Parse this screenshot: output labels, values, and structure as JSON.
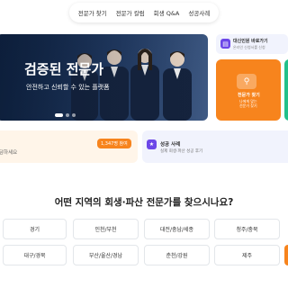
{
  "nav": {
    "items": [
      "전문가 찾기",
      "전문가 칼럼",
      "회생 Q&A",
      "성공사례"
    ]
  },
  "hero": {
    "title": "검증된 전문가",
    "subtitle": "안전하고 신뢰할 수 있는 플랫폼",
    "slide_count": 3,
    "active_slide": 1
  },
  "side_top": {
    "label": "대신인원 바로가기",
    "sub": "온라인 신청서를 신청"
  },
  "orange_card": {
    "label": "전문가 찾기",
    "sub": "나에게 맞는 전문가 찾기"
  },
  "band_left": {
    "text": "담하세요",
    "badge": "1,347명 참여"
  },
  "band_right": {
    "title": "성공 사례",
    "sub": "실제 회생·파산 성공 후기"
  },
  "region": {
    "heading": "어떤 지역의 회생·파산 전문가를 찾으시나요?",
    "row1": [
      "경기",
      "인천/부천",
      "대전/충남/세종",
      "청주/충북"
    ],
    "row2": [
      "대구/경북",
      "부산/울산/경남",
      "춘천/강원",
      "제주"
    ]
  },
  "colors": {
    "accent_orange": "#f7841d",
    "accent_purple": "#6c47e8",
    "accent_green": "#22c08a",
    "hero_navy": "#1b3256"
  },
  "icons": [
    "document-icon",
    "search-user-icon",
    "trophy-icon"
  ]
}
